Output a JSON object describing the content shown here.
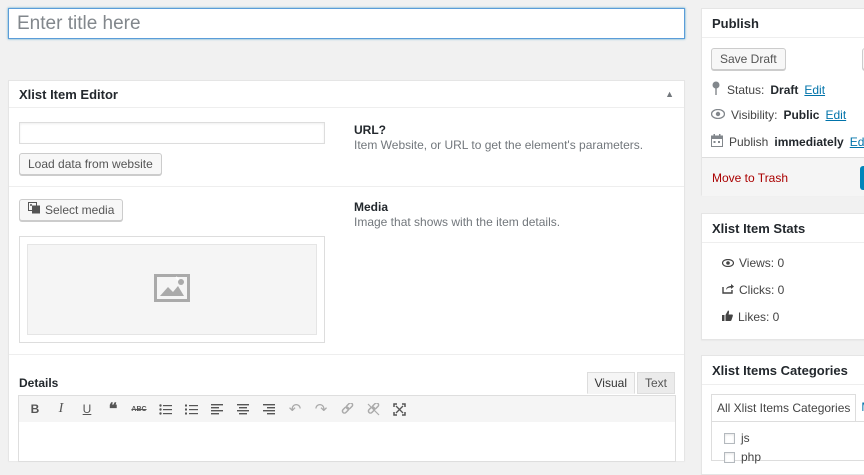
{
  "title": {
    "placeholder": "Enter title here"
  },
  "editor_box": {
    "heading": "Xlist Item Editor",
    "url_input_value": "",
    "load_button": "Load data from website",
    "url_label": "URL?",
    "url_desc": "Item Website, or URL to get the element's parameters.",
    "select_media_button": "Select media",
    "media_label": "Media",
    "media_desc": "Image that shows with the item details.",
    "details_label": "Details",
    "tab_visual": "Visual",
    "tab_text": "Text",
    "toolbar_icons": [
      "bold-icon",
      "italic-icon",
      "underline-icon",
      "blockquote-icon",
      "strikethrough-icon",
      "bullet-list-icon",
      "numbered-list-icon",
      "align-left-icon",
      "align-center-icon",
      "align-right-icon",
      "undo-icon",
      "redo-icon",
      "link-icon",
      "unlink-icon",
      "fullscreen-icon"
    ]
  },
  "publish": {
    "heading": "Publish",
    "save_draft": "Save Draft",
    "status_label": "Status:",
    "status_value": "Draft",
    "visibility_label": "Visibility:",
    "visibility_value": "Public",
    "publish_label": "Publish",
    "publish_value": "immediately",
    "edit_link": "Edit",
    "trash": "Move to Trash"
  },
  "stats": {
    "heading": "Xlist Item Stats",
    "views": "Views: 0",
    "clicks": "Clicks: 0",
    "likes": "Likes: 0"
  },
  "categories": {
    "heading": "Xlist Items Categories",
    "tab_all": "All Xlist Items Categories",
    "tab_most": "Mo",
    "items": [
      "js",
      "php"
    ]
  },
  "colors": {
    "accent": "#0073aa",
    "trash": "#a00000",
    "focus_border": "#5b9dd9"
  }
}
